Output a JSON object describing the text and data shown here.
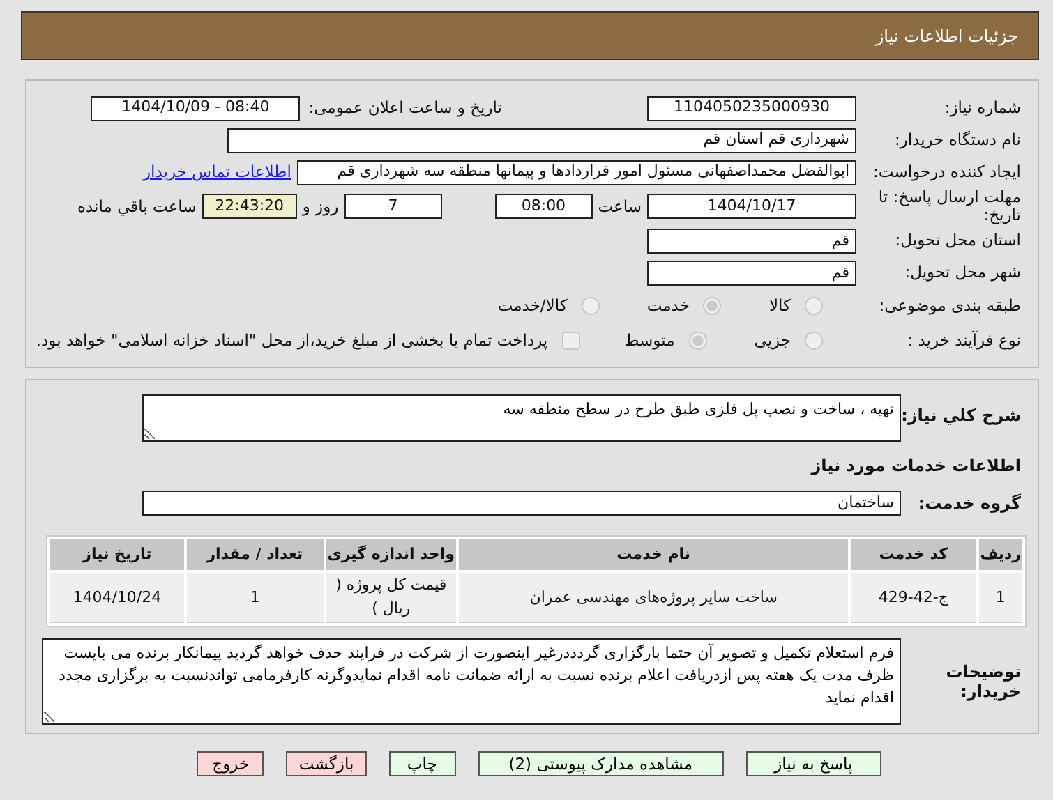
{
  "header": {
    "title": "جزئیات اطلاعات نیاز"
  },
  "need_number": {
    "label": "شماره نیاز:",
    "value": "1104050235000930"
  },
  "announce": {
    "label": "تاریخ و ساعت اعلان عمومی:",
    "value": "1404/10/09 - 08:40"
  },
  "buyer_org": {
    "label": "نام دستگاه خریدار:",
    "value": "شهرداری قم استان قم"
  },
  "requester": {
    "label": "ایجاد کننده درخواست:",
    "value": "ابوالفضل محمداصفهانی مسئول امور قراردادها و پیمانها منطقه سه شهرداری قم",
    "link": "اطلاعات تماس خریدار"
  },
  "deadline": {
    "label": "مهلت ارسال پاسخ: تا تاریخ:",
    "date": "1404/10/17",
    "time_label": "ساعت",
    "time": "08:00",
    "days": "7",
    "days_label": "روز و",
    "remaining": "22:43:20",
    "remaining_label": "ساعت باقي مانده"
  },
  "province": {
    "label": "استان محل تحویل:",
    "value": "قم"
  },
  "city": {
    "label": "شهر محل تحویل:",
    "value": "قم"
  },
  "category": {
    "label": "طبقه بندی موضوعی:",
    "options": [
      {
        "label": "کالا",
        "selected": false
      },
      {
        "label": "خدمت",
        "selected": true
      },
      {
        "label": "کالا/خدمت",
        "selected": false
      }
    ]
  },
  "process": {
    "label": "نوع فرآیند خرید :",
    "options": [
      {
        "label": "جزیی",
        "selected": false
      },
      {
        "label": "متوسط",
        "selected": true
      }
    ],
    "payment": {
      "label": "پرداخت تمام یا بخشی از مبلغ خرید،از محل \"اسناد خزانه اسلامی\" خواهد بود.",
      "checked": false
    }
  },
  "description": {
    "label": "شرح کلي نیاز:",
    "value": "تهیه ، ساخت و نصب پل فلزی طبق طرح در سطح منطقه سه"
  },
  "services_title": "اطلاعات خدمات مورد نیاز",
  "service_group": {
    "label": "گروه خدمت:",
    "value": "ساختمان"
  },
  "table": {
    "columns": [
      "ردیف",
      "کد خدمت",
      "نام خدمت",
      "واحد اندازه گیری",
      "تعداد / مقدار",
      "تاریخ نیاز"
    ],
    "rows": [
      [
        "1",
        "ج-42-429",
        "ساخت سایر پروژه‌های مهندسی عمران",
        "قیمت کل پروژه ( ریال )",
        "1",
        "1404/10/24"
      ]
    ]
  },
  "notes": {
    "label": "توضیحات خریدار:",
    "value": "فرم استعلام تکمیل و تصویر آن حتما بارگزاری گردددرغیر اینصورت از شرکت در فرایند حذف خواهد گردید پیمانکار برنده می بایست ظرف مدت یک هفته پس ازدریافت اعلام برنده نسبت به ارائه ضمانت نامه اقدام نمایدوگرنه کارفرمامی تواندنسبت به برگزاری مجدد اقدام نماید"
  },
  "buttons": [
    {
      "label": "پاسخ به نیاز",
      "kind": "action"
    },
    {
      "label": "مشاهده مدارک پیوستی (2)",
      "kind": "action"
    },
    {
      "label": "چاپ",
      "kind": "action"
    },
    {
      "label": "بازگشت",
      "kind": "exit"
    },
    {
      "label": "خروج",
      "kind": "exit"
    }
  ]
}
